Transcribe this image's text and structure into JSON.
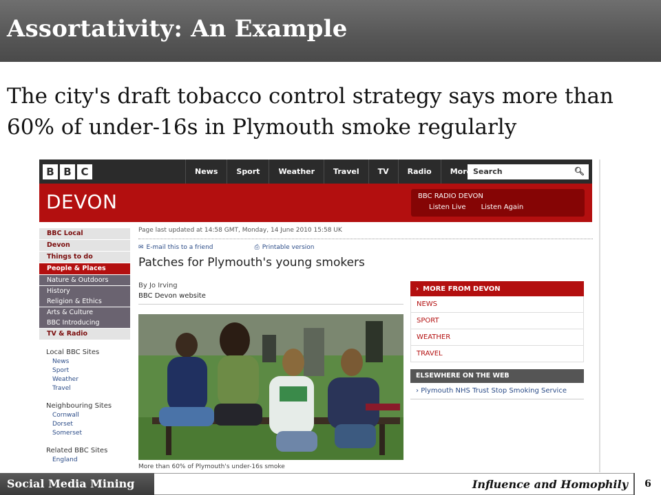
{
  "slide": {
    "title": "Assortativity: An Example",
    "subtitle": "The city's draft tobacco control strategy says more than 60% of under-16s in Plymouth smoke regularly"
  },
  "bbc": {
    "logo_letters": [
      "B",
      "B",
      "C"
    ],
    "nav": [
      "News",
      "Sport",
      "Weather",
      "Travel",
      "TV",
      "Radio",
      "More..."
    ],
    "search_placeholder": "Search",
    "region_title": "DEVON",
    "radio": {
      "title": "BBC RADIO DEVON",
      "links": [
        "Listen Live",
        "Listen Again"
      ]
    },
    "left_nav": {
      "top_items": [
        "BBC Local",
        "Devon",
        "Things to do"
      ],
      "active_item": "People & Places",
      "sub_items": [
        "Nature & Outdoors",
        "History",
        "Religion & Ethics",
        "Arts & Culture",
        "BBC Introducing"
      ],
      "tail_item": "TV & Radio",
      "sections": [
        {
          "title": "Local BBC Sites",
          "links": [
            "News",
            "Sport",
            "Weather",
            "Travel"
          ]
        },
        {
          "title": "Neighbouring Sites",
          "links": [
            "Cornwall",
            "Dorset",
            "Somerset"
          ]
        },
        {
          "title": "Related BBC Sites",
          "links": [
            "England"
          ]
        }
      ]
    },
    "article": {
      "updated": "Page last updated at 14:58 GMT, Monday, 14 June 2010 15:58 UK",
      "email_link": "E-mail this to a friend",
      "print_link": "Printable version",
      "headline": "Patches for Plymouth's young smokers",
      "author": "By Jo Irving",
      "source": "BBC Devon website",
      "caption": "More than 60% of Plymouth's under-16s smoke"
    },
    "more_from": {
      "title": "MORE FROM DEVON",
      "links": [
        "NEWS",
        "SPORT",
        "WEATHER",
        "TRAVEL"
      ]
    },
    "elsewhere": {
      "title": "ELSEWHERE ON THE WEB",
      "links": [
        "Plymouth NHS Trust Stop Smoking Service"
      ]
    }
  },
  "footer": {
    "left": "Social Media Mining",
    "mid": "Influence and Homophily",
    "page": "6"
  },
  "colors": {
    "bbc_red": "#b30f0f",
    "bbc_dark": "#2b2b2b",
    "link_blue": "#2a4b87"
  }
}
